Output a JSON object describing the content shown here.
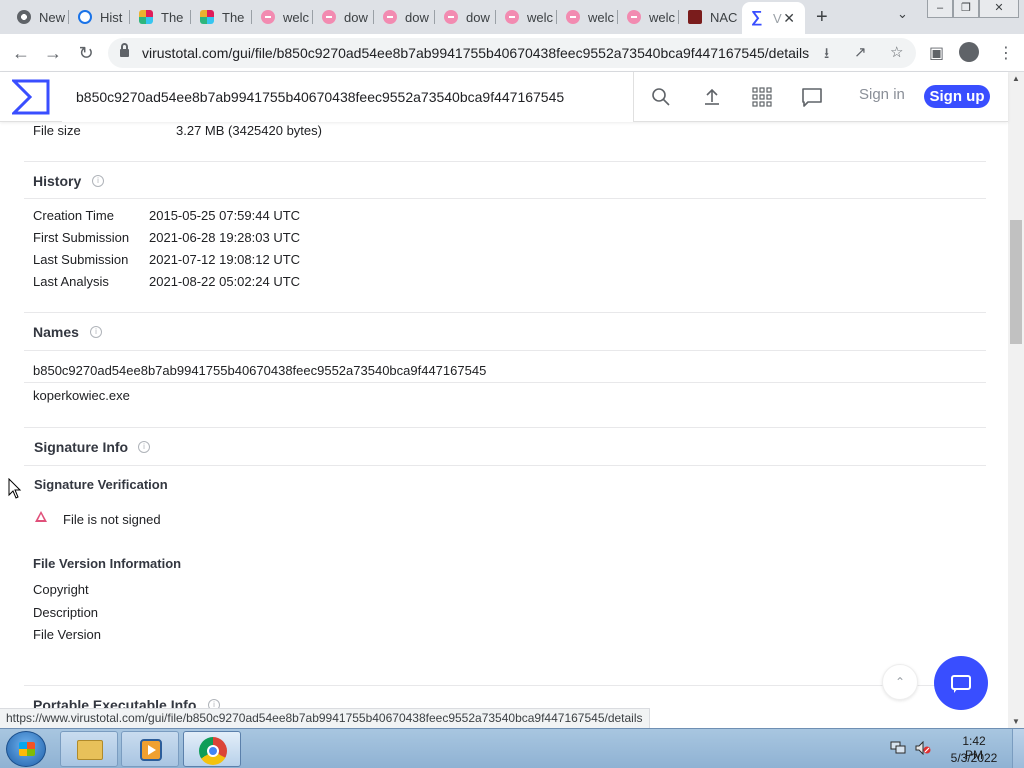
{
  "browser": {
    "tabs": [
      {
        "label": "New",
        "icon": "chrome-icon"
      },
      {
        "label": "Hist",
        "icon": "history-icon"
      },
      {
        "label": "The",
        "icon": "slack-icon"
      },
      {
        "label": "The",
        "icon": "slack-icon"
      },
      {
        "label": "welc",
        "icon": "pink-site-icon"
      },
      {
        "label": "dow",
        "icon": "pink-site-icon"
      },
      {
        "label": "dow",
        "icon": "pink-site-icon"
      },
      {
        "label": "dow",
        "icon": "pink-site-icon"
      },
      {
        "label": "welc",
        "icon": "pink-site-icon"
      },
      {
        "label": "welc",
        "icon": "pink-site-icon"
      },
      {
        "label": "welc",
        "icon": "pink-site-icon"
      },
      {
        "label": "NAC",
        "icon": "nac-icon"
      },
      {
        "label": "V",
        "icon": "virustotal-icon",
        "active": true
      }
    ],
    "url": "virustotal.com/gui/file/b850c9270ad54ee8b7ab9941755b40670438feec9552a73540bca9f447167545/details",
    "status_url": "https://www.virustotal.com/gui/file/b850c9270ad54ee8b7ab9941755b40670438feec9552a73540bca9f447167545/details"
  },
  "vt": {
    "search_value": "b850c9270ad54ee8b7ab9941755b40670438feec9552a73540bca9f447167545",
    "sign_in": "Sign in",
    "sign_up": "Sign up",
    "brand_color": "#394eff"
  },
  "file_size": {
    "label": "File size",
    "value": "3.27 MB (3425420 bytes)"
  },
  "history": {
    "title": "History",
    "rows": [
      {
        "label": "Creation Time",
        "value": "2015-05-25 07:59:44 UTC"
      },
      {
        "label": "First Submission",
        "value": "2021-06-28 19:28:03 UTC"
      },
      {
        "label": "Last Submission",
        "value": "2021-07-12 19:08:12 UTC"
      },
      {
        "label": "Last Analysis",
        "value": "2021-08-22 05:02:24 UTC"
      }
    ]
  },
  "names": {
    "title": "Names",
    "items": [
      "b850c9270ad54ee8b7ab9941755b40670438feec9552a73540bca9f447167545",
      "koperkowiec.exe"
    ]
  },
  "signature": {
    "title": "Signature Info",
    "verification_heading": "Signature Verification",
    "verification_status": "File is not signed",
    "version_heading": "File Version Information",
    "version_fields": [
      "Copyright",
      "Description",
      "File Version"
    ]
  },
  "pe_info": {
    "title": "Portable Executable Info"
  },
  "taskbar": {
    "time": "1:42 PM",
    "date": "5/3/2022"
  }
}
